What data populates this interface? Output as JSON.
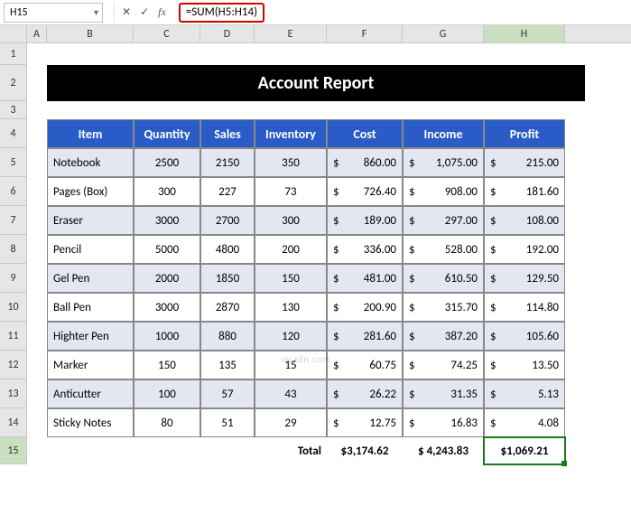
{
  "formula_bar": {
    "cell_ref": "H15",
    "formula": "=SUM(H5:H14)"
  },
  "columns": [
    "A",
    "B",
    "C",
    "D",
    "E",
    "F",
    "G",
    "H"
  ],
  "rows": [
    "1",
    "2",
    "3",
    "4",
    "5",
    "6",
    "7",
    "8",
    "9",
    "10",
    "11",
    "12",
    "13",
    "14",
    "15"
  ],
  "title": "Account Report",
  "headers": {
    "item": "Item",
    "quantity": "Quantity",
    "sales": "Sales",
    "inventory": "Inventory",
    "cost": "Cost",
    "income": "Income",
    "profit": "Profit"
  },
  "data": [
    {
      "item": "Notebook",
      "quantity": "2500",
      "sales": "2150",
      "inventory": "350",
      "cost": "860.00",
      "income": "1,075.00",
      "profit": "215.00"
    },
    {
      "item": "Pages (Box)",
      "quantity": "300",
      "sales": "227",
      "inventory": "73",
      "cost": "726.40",
      "income": "908.00",
      "profit": "181.60"
    },
    {
      "item": "Eraser",
      "quantity": "3000",
      "sales": "2700",
      "inventory": "300",
      "cost": "189.00",
      "income": "297.00",
      "profit": "108.00"
    },
    {
      "item": "Pencil",
      "quantity": "5000",
      "sales": "4800",
      "inventory": "200",
      "cost": "336.00",
      "income": "528.00",
      "profit": "192.00"
    },
    {
      "item": "Gel Pen",
      "quantity": "2000",
      "sales": "1850",
      "inventory": "150",
      "cost": "481.00",
      "income": "610.50",
      "profit": "129.50"
    },
    {
      "item": "Ball Pen",
      "quantity": "3000",
      "sales": "2870",
      "inventory": "130",
      "cost": "200.90",
      "income": "315.70",
      "profit": "114.80"
    },
    {
      "item": "Highter Pen",
      "quantity": "1000",
      "sales": "880",
      "inventory": "120",
      "cost": "281.60",
      "income": "387.20",
      "profit": "105.60"
    },
    {
      "item": "Marker",
      "quantity": "150",
      "sales": "135",
      "inventory": "15",
      "cost": "60.75",
      "income": "74.25",
      "profit": "13.50"
    },
    {
      "item": "Anticutter",
      "quantity": "100",
      "sales": "57",
      "inventory": "43",
      "cost": "26.22",
      "income": "31.35",
      "profit": "5.13"
    },
    {
      "item": "Sticky Notes",
      "quantity": "80",
      "sales": "51",
      "inventory": "29",
      "cost": "12.75",
      "income": "16.83",
      "profit": "4.08"
    }
  ],
  "totals": {
    "label": "Total",
    "cost": "$3,174.62",
    "income": "$ 4,243.83",
    "profit": "$1,069.21"
  },
  "currency": "$",
  "watermark": "wcxdn.com",
  "chart_data": {
    "type": "table",
    "title": "Account Report",
    "columns": [
      "Item",
      "Quantity",
      "Sales",
      "Inventory",
      "Cost",
      "Income",
      "Profit"
    ],
    "rows": [
      [
        "Notebook",
        2500,
        2150,
        350,
        860.0,
        1075.0,
        215.0
      ],
      [
        "Pages (Box)",
        300,
        227,
        73,
        726.4,
        908.0,
        181.6
      ],
      [
        "Eraser",
        3000,
        2700,
        300,
        189.0,
        297.0,
        108.0
      ],
      [
        "Pencil",
        5000,
        4800,
        200,
        336.0,
        528.0,
        192.0
      ],
      [
        "Gel Pen",
        2000,
        1850,
        150,
        481.0,
        610.5,
        129.5
      ],
      [
        "Ball Pen",
        3000,
        2870,
        130,
        200.9,
        315.7,
        114.8
      ],
      [
        "Highter Pen",
        1000,
        880,
        120,
        281.6,
        387.2,
        105.6
      ],
      [
        "Marker",
        150,
        135,
        15,
        60.75,
        74.25,
        13.5
      ],
      [
        "Anticutter",
        100,
        57,
        43,
        26.22,
        31.35,
        5.13
      ],
      [
        "Sticky Notes",
        80,
        51,
        29,
        12.75,
        16.83,
        4.08
      ]
    ],
    "totals": {
      "Cost": 3174.62,
      "Income": 4243.83,
      "Profit": 1069.21
    }
  }
}
